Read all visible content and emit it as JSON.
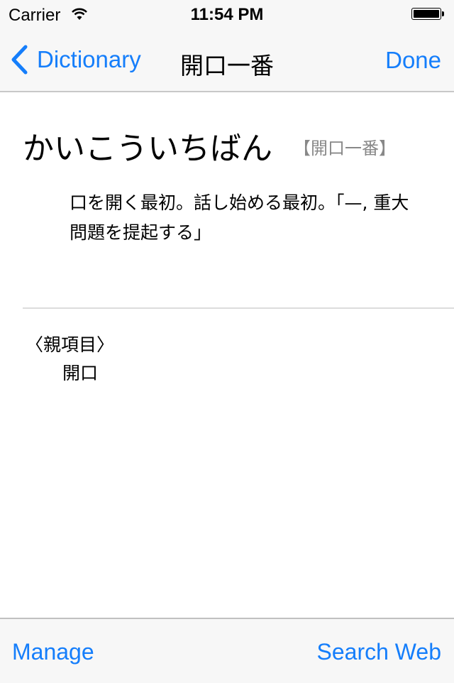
{
  "status_bar": {
    "carrier": "Carrier",
    "time": "11:54 PM",
    "battery_level": 1.0
  },
  "nav_bar": {
    "back_label": "Dictionary",
    "title": "開口一番",
    "done_label": "Done"
  },
  "entry": {
    "reading": "かいこういちばん",
    "kanji": "【開口一番】",
    "definition": "口を開く最初。話し始める最初。「—, 重大問題を提起する」",
    "parent_label": "〈親項目〉",
    "parent_item": "開口"
  },
  "toolbar": {
    "manage_label": "Manage",
    "search_web_label": "Search Web"
  },
  "colors": {
    "accent": "#157efb",
    "bar_background": "#f7f7f7",
    "kanji_gray": "#888888"
  }
}
